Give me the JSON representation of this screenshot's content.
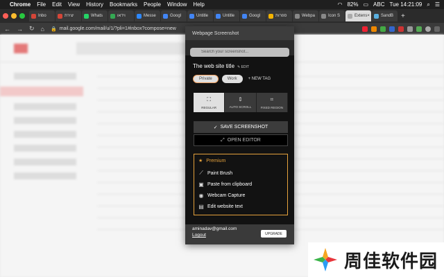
{
  "menubar": {
    "app": "Chrome",
    "items": [
      "File",
      "Edit",
      "View",
      "History",
      "Bookmarks",
      "People",
      "Window",
      "Help"
    ],
    "battery": "82%",
    "input": "ABC",
    "clock": "Tue 14:21:09"
  },
  "tabs": [
    {
      "label": "Inbo",
      "color": "#d44638"
    },
    {
      "label": "יצירת",
      "color": "#d44638"
    },
    {
      "label": "Whats",
      "color": "#25d366"
    },
    {
      "label": "וידאו",
      "color": "#34a853"
    },
    {
      "label": "Messe",
      "color": "#2d88ff"
    },
    {
      "label": "Googl",
      "color": "#4285f4"
    },
    {
      "label": "Untitle",
      "color": "#4285f4"
    },
    {
      "label": "Untitle",
      "color": "#4285f4"
    },
    {
      "label": "Googl",
      "color": "#4285f4"
    },
    {
      "label": "ספרות",
      "color": "#f4b400"
    },
    {
      "label": "Webpa",
      "color": "#888888"
    },
    {
      "label": "Icon S",
      "color": "#888888"
    },
    {
      "label": "Extens",
      "color": "#aaaaaa",
      "active": true
    },
    {
      "label": "SandB",
      "color": "#5ab0e0"
    }
  ],
  "address": {
    "url": "mail.google.com/mail/u/1/?pli=1#inbox?compose=new"
  },
  "popup": {
    "title": "Webpage Screenshot",
    "search_placeholder": "Search your screenshot...",
    "site_title": "The web site title",
    "edit_label": "EDIT",
    "tags": [
      "Private",
      "Work"
    ],
    "new_tag": "+ NEW TAG",
    "modes": [
      {
        "label": "REGULAR",
        "icon": "regular-capture-icon",
        "active": true
      },
      {
        "label": "AUTO SCROLL",
        "icon": "auto-scroll-icon",
        "active": false
      },
      {
        "label": "FIXED REGION",
        "icon": "crop-icon",
        "active": false
      }
    ],
    "save_button": "SAVE SCREENSHOT",
    "editor_button": "OPEN EDITOR",
    "premium": {
      "title": "Premium",
      "items": [
        {
          "label": "Paint Brush",
          "icon": "brush-icon"
        },
        {
          "label": "Paste from clipboard",
          "icon": "clipboard-icon"
        },
        {
          "label": "Webcam Capture",
          "icon": "webcam-icon"
        },
        {
          "label": "Edit website text",
          "icon": "text-edit-icon"
        }
      ]
    },
    "user_email": "aminadav@gmail.com",
    "logout": "Logout",
    "upgrade": "UPGRADE"
  },
  "watermark": {
    "text": "周佳软件园"
  },
  "colors": {
    "accent": "#e6a23c",
    "popup_bg": "#121212"
  }
}
